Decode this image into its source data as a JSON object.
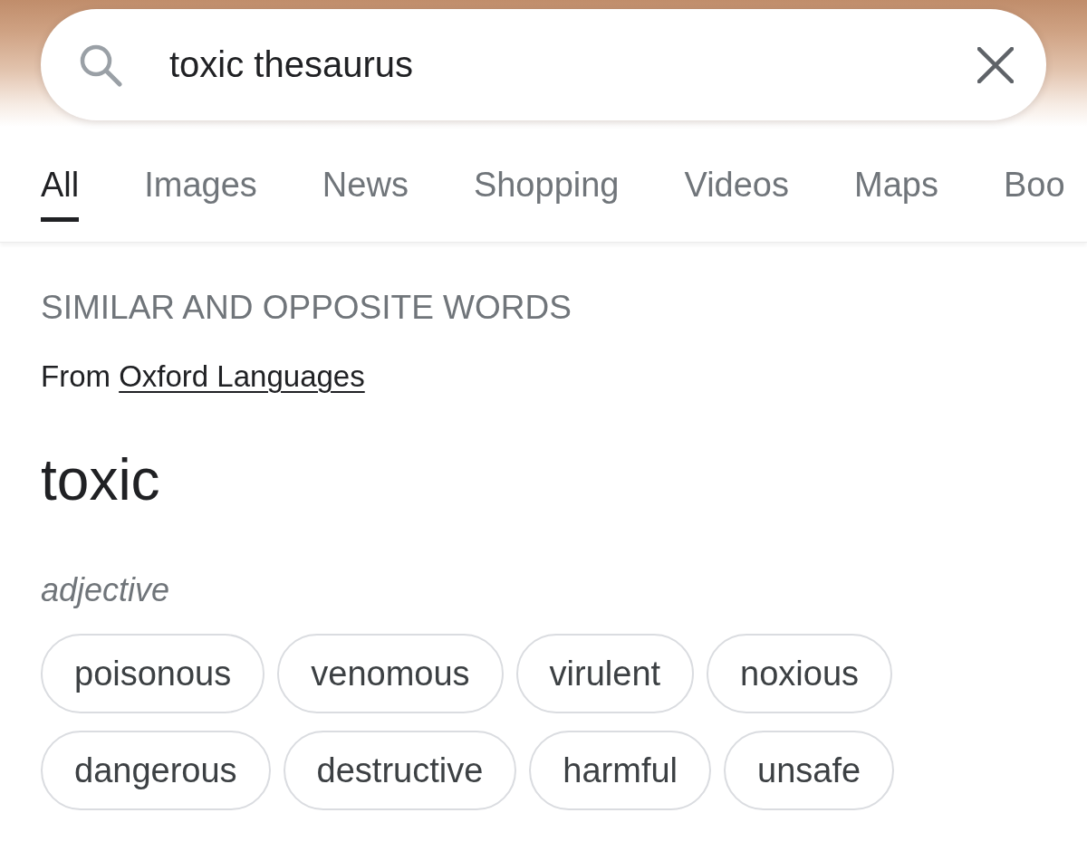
{
  "search": {
    "query": "toxic thesaurus"
  },
  "tabs": [
    {
      "label": "All",
      "selected": true
    },
    {
      "label": "Images",
      "selected": false
    },
    {
      "label": "News",
      "selected": false
    },
    {
      "label": "Shopping",
      "selected": false
    },
    {
      "label": "Videos",
      "selected": false
    },
    {
      "label": "Maps",
      "selected": false
    },
    {
      "label": "Boo",
      "selected": false
    }
  ],
  "result": {
    "heading": "SIMILAR AND OPPOSITE WORDS",
    "source": {
      "prefix": "From",
      "link": "Oxford Languages"
    },
    "word": "toxic",
    "part_of_speech": "adjective",
    "synonyms": [
      "poisonous",
      "venomous",
      "virulent",
      "noxious",
      "dangerous",
      "destructive",
      "harmful",
      "unsafe"
    ]
  }
}
